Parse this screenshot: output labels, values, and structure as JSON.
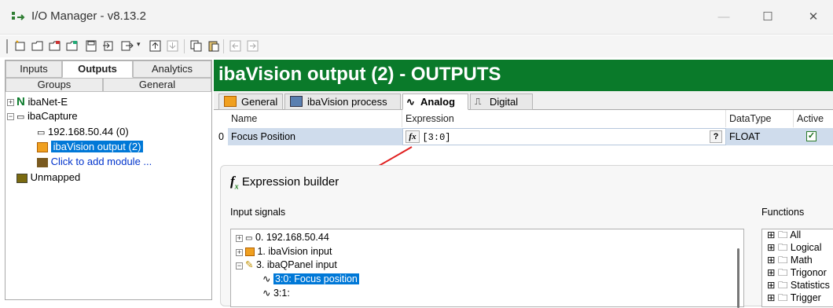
{
  "window": {
    "title": "I/O Manager - v8.13.2",
    "minimize": "—",
    "maximize": "☐",
    "close": "✕"
  },
  "toolbar": {
    "icons": [
      "new-module-icon",
      "new-group-icon",
      "new-group-b-icon",
      "new-group-c-icon",
      "save-icon",
      "import-icon",
      "export-icon",
      "move-up-icon",
      "move-down-icon",
      "copy-icon",
      "paste-icon",
      "undo-icon",
      "redo-icon"
    ]
  },
  "left_tabs_row1": [
    "Inputs",
    "Outputs",
    "Analytics"
  ],
  "left_tabs_row2": [
    "Groups",
    "General"
  ],
  "tree": {
    "ibanet": "ibaNet-E",
    "ibacapture": "ibaCapture",
    "ip": "192.168.50.44 (0)",
    "vision_output": "ibaVision output (2)",
    "add_module": "Click to add module ...",
    "unmapped": "Unmapped"
  },
  "header": {
    "title": "ibaVision output (2) - OUTPUTS",
    "bg": "#0a7a2a"
  },
  "right_tabs": [
    "General",
    "ibaVision process",
    "Analog",
    "Digital"
  ],
  "grid": {
    "columns": [
      "Name",
      "Expression",
      "DataType",
      "Active"
    ],
    "row": {
      "index": "0",
      "name": "Focus Position",
      "fx": "fx",
      "expression": "[3:0]",
      "help": "?",
      "datatype": "FLOAT",
      "active": "✓"
    }
  },
  "builder": {
    "title": "Expression builder",
    "input_signals_label": "Input signals",
    "functions_label": "Functions",
    "signals": [
      "0. 192.168.50.44",
      "1. ibaVision input",
      "3. ibaQPanel input",
      "3:0: Focus position",
      "3:1:"
    ],
    "functions": [
      "All",
      "Logical",
      "Math",
      "Trigonor",
      "Statistics",
      "Trigger"
    ]
  }
}
